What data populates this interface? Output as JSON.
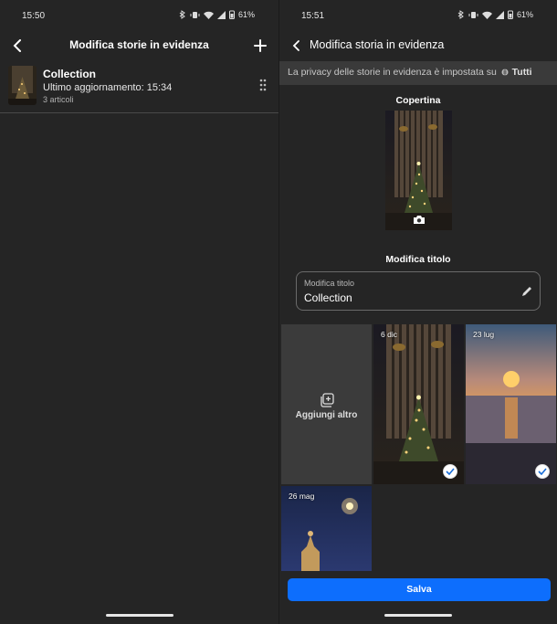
{
  "left_screen": {
    "status": {
      "time": "15:50",
      "battery": "61%"
    },
    "header": {
      "title": "Modifica storie in evidenza"
    },
    "highlight": {
      "name": "Collection",
      "updated": "Ultimo aggiornamento: 15:34",
      "count": "3 articoli"
    }
  },
  "right_screen": {
    "status": {
      "time": "15:51",
      "battery": "61%"
    },
    "header": {
      "title": "Modifica storia in evidenza"
    },
    "privacy": {
      "text": "La privacy delle storie in evidenza è impostata su",
      "audience": "Tutti"
    },
    "cover": {
      "label": "Copertina"
    },
    "edit_title": {
      "section_label": "Modifica titolo",
      "field_label": "Modifica titolo",
      "value": "Collection"
    },
    "grid": {
      "add_label": "Aggiungi altro",
      "items": [
        {
          "date": "6 dic",
          "selected": true
        },
        {
          "date": "23 lug",
          "selected": true
        },
        {
          "date": "26 mag",
          "selected": false
        }
      ]
    },
    "save_label": "Salva"
  },
  "colors": {
    "background": "#252525",
    "accent": "#0d6efd",
    "banner": "#3a3a3a"
  }
}
